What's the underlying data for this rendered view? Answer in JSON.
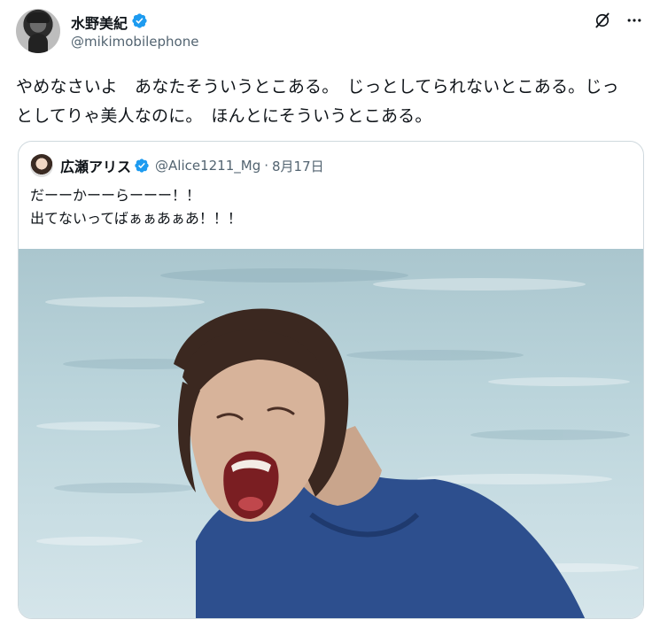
{
  "author": {
    "display_name": "水野美紀",
    "handle": "@mikimobilephone",
    "verified": true
  },
  "icons": {
    "verified": "verified-badge-icon",
    "grok": "grok-icon",
    "more": "more-options-icon"
  },
  "post": {
    "text": "やめなさいよ　あなたそういうとこある。　じっとしてられないとこある。じっとしてりゃ美人なのに。　ほんとにそういうとこある。"
  },
  "quoted_post": {
    "display_name": "広瀬アリス",
    "handle": "@Alice1211_Mg",
    "separator": "·",
    "date": "8月17日",
    "verified": true,
    "text": "だーーかーーらーーー！！\n出てないってばぁぁあぁあ！！！"
  },
  "colors": {
    "text": "#0f1419",
    "secondary": "#536471",
    "verified": "#1d9bf0",
    "border": "#cfd9de"
  }
}
